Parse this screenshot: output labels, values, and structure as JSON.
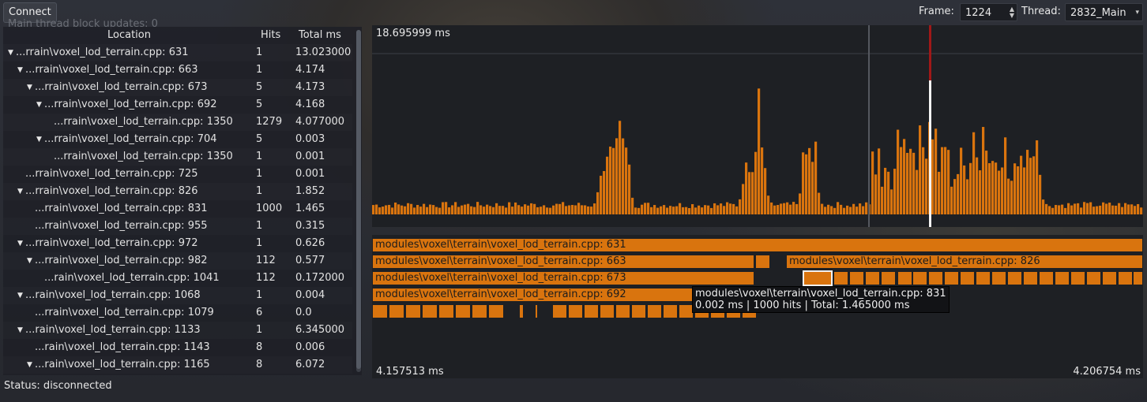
{
  "toolbar": {
    "connect_label": "Connect",
    "ghost_text": "Main thread block updates: 0",
    "frame_label": "Frame:",
    "frame_value": "1224",
    "thread_label": "Thread:",
    "thread_value": "2832_Main"
  },
  "tree": {
    "headers": {
      "location": "Location",
      "hits": "Hits",
      "total": "Total ms"
    },
    "rows": [
      {
        "location": "...rrain\\voxel_lod_terrain.cpp: 631",
        "hits": "1",
        "total": "13.023000",
        "depth": 0,
        "expanded": true
      },
      {
        "location": "...rrain\\voxel_lod_terrain.cpp: 663",
        "hits": "1",
        "total": "4.174",
        "depth": 1,
        "expanded": true
      },
      {
        "location": "...rrain\\voxel_lod_terrain.cpp: 673",
        "hits": "5",
        "total": "4.173",
        "depth": 2,
        "expanded": true
      },
      {
        "location": "...rrain\\voxel_lod_terrain.cpp: 692",
        "hits": "5",
        "total": "4.168",
        "depth": 3,
        "expanded": true
      },
      {
        "location": "...rrain\\voxel_lod_terrain.cpp: 1350",
        "hits": "1279",
        "total": "4.077000",
        "depth": 4,
        "expanded": false
      },
      {
        "location": "...rrain\\voxel_lod_terrain.cpp: 704",
        "hits": "5",
        "total": "0.003",
        "depth": 3,
        "expanded": true
      },
      {
        "location": "...rrain\\voxel_lod_terrain.cpp: 1350",
        "hits": "1",
        "total": "0.001",
        "depth": 4,
        "expanded": false
      },
      {
        "location": "...rrain\\voxel_lod_terrain.cpp: 725",
        "hits": "1",
        "total": "0.001",
        "depth": 1,
        "expanded": false
      },
      {
        "location": "...rrain\\voxel_lod_terrain.cpp: 826",
        "hits": "1",
        "total": "1.852",
        "depth": 1,
        "expanded": true
      },
      {
        "location": "...rrain\\voxel_lod_terrain.cpp: 831",
        "hits": "1000",
        "total": "1.465",
        "depth": 2,
        "expanded": false
      },
      {
        "location": "...rrain\\voxel_lod_terrain.cpp: 955",
        "hits": "1",
        "total": "0.315",
        "depth": 2,
        "expanded": false
      },
      {
        "location": "...rrain\\voxel_lod_terrain.cpp: 972",
        "hits": "1",
        "total": "0.626",
        "depth": 1,
        "expanded": true
      },
      {
        "location": "...rrain\\voxel_lod_terrain.cpp: 982",
        "hits": "112",
        "total": "0.577",
        "depth": 2,
        "expanded": true
      },
      {
        "location": "...rain\\voxel_lod_terrain.cpp: 1041",
        "hits": "112",
        "total": "0.172000",
        "depth": 3,
        "expanded": false
      },
      {
        "location": "...rain\\voxel_lod_terrain.cpp: 1068",
        "hits": "1",
        "total": "0.004",
        "depth": 1,
        "expanded": true
      },
      {
        "location": "...rrain\\voxel_lod_terrain.cpp: 1079",
        "hits": "6",
        "total": "0.0",
        "depth": 2,
        "expanded": false
      },
      {
        "location": "...rain\\voxel_lod_terrain.cpp: 1133",
        "hits": "1",
        "total": "6.345000",
        "depth": 1,
        "expanded": true
      },
      {
        "location": "...rain\\voxel_lod_terrain.cpp: 1143",
        "hits": "8",
        "total": "0.006",
        "depth": 2,
        "expanded": false
      },
      {
        "location": "...rain\\voxel_lod_terrain.cpp: 1165",
        "hits": "8",
        "total": "6.072",
        "depth": 2,
        "expanded": true
      }
    ]
  },
  "graph": {
    "max_label": "18.695999 ms",
    "bar_color": "#d9740e",
    "selected_color": "#a01818"
  },
  "timeline": {
    "rows": [
      {
        "label": "modules\\voxel\\terrain\\voxel_lod_terrain.cpp: 631"
      },
      {
        "label": "modules\\voxel\\terrain\\voxel_lod_terrain.cpp: 663"
      },
      {
        "label": "modules\\voxel\\terrain\\voxel_lod_terrain.cpp: 826"
      },
      {
        "label": "modules\\voxel\\terrain\\voxel_lod_terrain.cpp: 673"
      },
      {
        "label": "modules\\voxel\\terrain\\voxel_lod_terrain.cpp: 692"
      }
    ],
    "tooltip_line1": "modules\\voxel\\terrain\\voxel_lod_terrain.cpp: 831",
    "tooltip_line2": "0.002 ms | 1000 hits | Total: 1.465000 ms",
    "start_label": "4.157513 ms",
    "end_label": "4.206754 ms"
  },
  "status": {
    "text": "Status: disconnected"
  }
}
